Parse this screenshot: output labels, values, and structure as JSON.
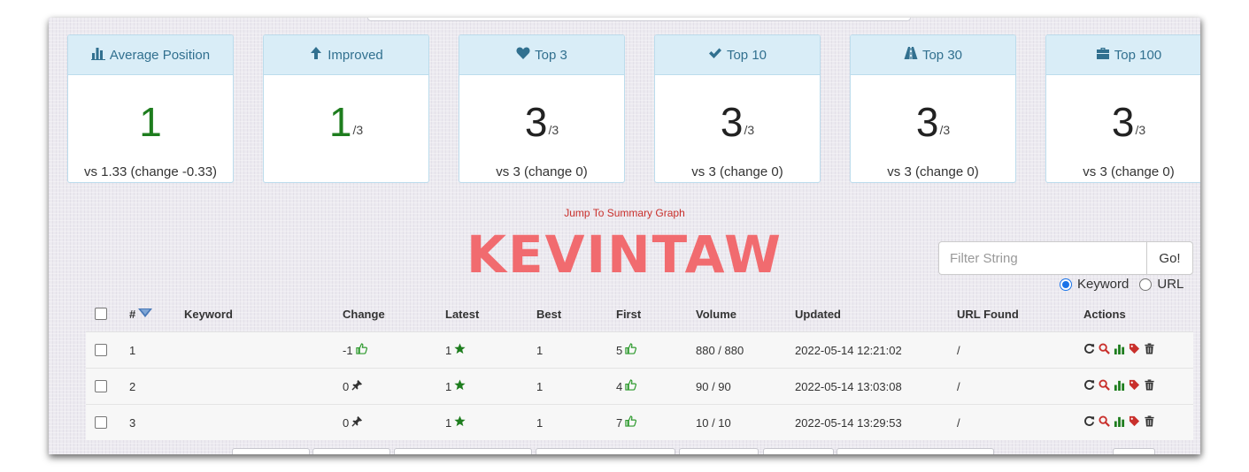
{
  "cards": [
    {
      "title": "Average Position",
      "icon": "bar-chart-icon",
      "value": "1",
      "denominator": "",
      "footer": "vs 1.33 (change -0.33)",
      "color": "#1e7d1e"
    },
    {
      "title": "Improved",
      "icon": "arrow-up-icon",
      "value": "1",
      "denominator": "/3",
      "footer": "",
      "color": "#1e7d1e"
    },
    {
      "title": "Top 3",
      "icon": "heart-icon",
      "value": "3",
      "denominator": "/3",
      "footer": "vs 3 (change 0)",
      "color": "#222222"
    },
    {
      "title": "Top 10",
      "icon": "checkmark-icon",
      "value": "3",
      "denominator": "/3",
      "footer": "vs 3 (change 0)",
      "color": "#222222"
    },
    {
      "title": "Top 30",
      "icon": "road-icon",
      "value": "3",
      "denominator": "/3",
      "footer": "vs 3 (change 0)",
      "color": "#222222"
    },
    {
      "title": "Top 100",
      "icon": "briefcase-icon",
      "value": "3",
      "denominator": "/3",
      "footer": "vs 3 (change 0)",
      "color": "#222222"
    }
  ],
  "jump_link": "Jump To Summary Graph",
  "brand": "KEVINTAW",
  "filter": {
    "placeholder": "Filter String",
    "button": "Go!"
  },
  "search_mode": {
    "options": [
      "Keyword",
      "URL"
    ],
    "selected": "Keyword"
  },
  "table": {
    "columns": [
      "#",
      "Keyword",
      "Change",
      "Latest",
      "Best",
      "First",
      "Volume",
      "Updated",
      "URL Found",
      "Actions"
    ],
    "rows": [
      {
        "num": "1",
        "change": "-1",
        "change_icon": "thumbs-up-icon",
        "latest": "1",
        "best": "1",
        "first": "5",
        "volume": "880 / 880",
        "updated": "2022-05-14 12:21:02",
        "url": "/"
      },
      {
        "num": "2",
        "change": "0",
        "change_icon": "pin-icon",
        "latest": "1",
        "best": "1",
        "first": "4",
        "volume": "90 / 90",
        "updated": "2022-05-14 13:03:08",
        "url": "/"
      },
      {
        "num": "3",
        "change": "0",
        "change_icon": "pin-icon",
        "latest": "1",
        "best": "1",
        "first": "7",
        "volume": "10 / 10",
        "updated": "2022-05-14 13:29:53",
        "url": "/"
      }
    ]
  },
  "colors": {
    "accent_green": "#1e7d1e",
    "card_header_bg": "#d9edf7",
    "card_header_text": "#31708f",
    "brand_red": "#f16b6f",
    "link_red": "#c9302c"
  }
}
